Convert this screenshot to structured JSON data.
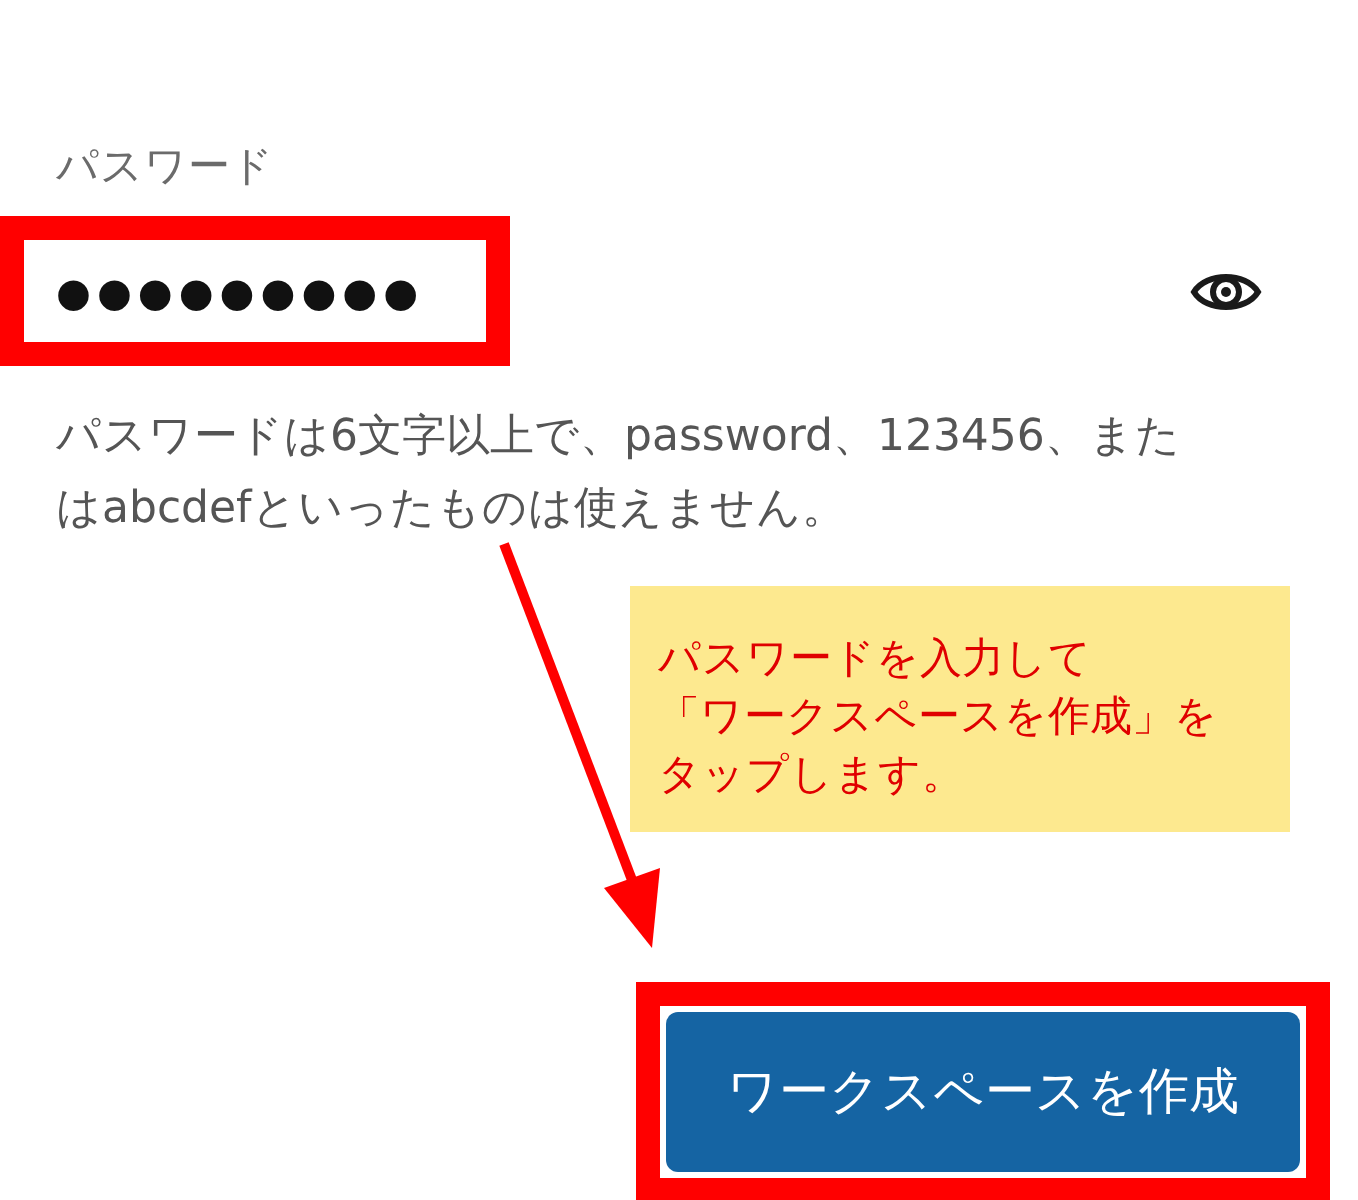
{
  "password_label": "パスワード",
  "password_field": {
    "value": "●●●●●●●●●",
    "highlighted": true
  },
  "help_text": "パスワードは6文字以上で、password、123456、またはabcdefといったものは使えません。",
  "callout": {
    "lines": [
      "パスワードを入力して",
      "「ワークスペースを作成」を",
      "タップします。"
    ]
  },
  "create_button": {
    "label": "ワークスペースを作成",
    "highlighted": true
  }
}
